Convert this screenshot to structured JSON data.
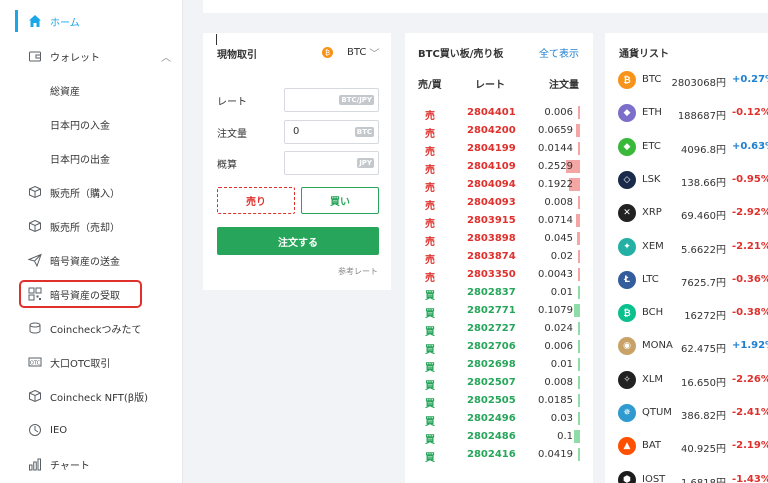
{
  "sidebar": {
    "items": [
      {
        "label": "ホーム",
        "icon": "home-icon"
      },
      {
        "label": "ウォレット",
        "icon": "wallet-icon"
      },
      {
        "label": "総資産"
      },
      {
        "label": "日本円の入金"
      },
      {
        "label": "日本円の出金"
      },
      {
        "label": "販売所（購入）",
        "icon": "box-icon"
      },
      {
        "label": "販売所（売却）",
        "icon": "box-icon"
      },
      {
        "label": "暗号資産の送金",
        "icon": "paper-plane-icon"
      },
      {
        "label": "暗号資産の受取",
        "icon": "qr-code-icon"
      },
      {
        "label": "Coincheckつみたて",
        "icon": "coin-stack-icon"
      },
      {
        "label": "大口OTC取引",
        "icon": "otc-icon"
      },
      {
        "label": "Coincheck NFT(β版)",
        "icon": "nft-cube-icon"
      },
      {
        "label": "IEO",
        "icon": "ieo-icon"
      },
      {
        "label": "チャート",
        "icon": "bar-chart-icon"
      }
    ]
  },
  "spot": {
    "title": "現物取引",
    "coin": "BTC",
    "rate_label": "レート",
    "rate_unit": "BTC/JPY",
    "qty_label": "注文量",
    "qty_value": "0",
    "qty_unit": "BTC",
    "approx_label": "概算",
    "approx_unit": "JPY",
    "sell_label": "売り",
    "buy_label": "買い",
    "order_label": "注文する",
    "ref_rate_label": "参考レート"
  },
  "orderbook": {
    "title": "BTC買い板/売り板",
    "show_all": "全て表示",
    "col_side": "売/買",
    "col_rate": "レート",
    "col_amount": "注文量",
    "rows": [
      {
        "side": "売",
        "rate": "2804401",
        "amount": "0.006",
        "depth": 0.02
      },
      {
        "side": "売",
        "rate": "2804200",
        "amount": "0.0659",
        "depth": 0.26
      },
      {
        "side": "売",
        "rate": "2804199",
        "amount": "0.0144",
        "depth": 0.06
      },
      {
        "side": "売",
        "rate": "2804109",
        "amount": "0.2529",
        "depth": 1.0
      },
      {
        "side": "売",
        "rate": "2804094",
        "amount": "0.1922",
        "depth": 0.76
      },
      {
        "side": "売",
        "rate": "2804093",
        "amount": "0.008",
        "depth": 0.03
      },
      {
        "side": "売",
        "rate": "2803915",
        "amount": "0.0714",
        "depth": 0.28
      },
      {
        "side": "売",
        "rate": "2803898",
        "amount": "0.045",
        "depth": 0.18
      },
      {
        "side": "売",
        "rate": "2803874",
        "amount": "0.02",
        "depth": 0.08
      },
      {
        "side": "売",
        "rate": "2803350",
        "amount": "0.0043",
        "depth": 0.02
      },
      {
        "side": "買",
        "rate": "2802837",
        "amount": "0.01",
        "depth": 0.04
      },
      {
        "side": "買",
        "rate": "2802771",
        "amount": "0.1079",
        "depth": 0.43
      },
      {
        "side": "買",
        "rate": "2802727",
        "amount": "0.024",
        "depth": 0.09
      },
      {
        "side": "買",
        "rate": "2802706",
        "amount": "0.006",
        "depth": 0.02
      },
      {
        "side": "買",
        "rate": "2802698",
        "amount": "0.01",
        "depth": 0.04
      },
      {
        "side": "買",
        "rate": "2802507",
        "amount": "0.008",
        "depth": 0.03
      },
      {
        "side": "買",
        "rate": "2802505",
        "amount": "0.0185",
        "depth": 0.07
      },
      {
        "side": "買",
        "rate": "2802496",
        "amount": "0.03",
        "depth": 0.12
      },
      {
        "side": "買",
        "rate": "2802486",
        "amount": "0.1",
        "depth": 0.4
      },
      {
        "side": "買",
        "rate": "2802416",
        "amount": "0.0419",
        "depth": 0.17
      }
    ]
  },
  "currencies": {
    "title": "通貨リスト",
    "rows": [
      {
        "symbol": "BTC",
        "price": "2803068円",
        "change": "+0.27%",
        "dir": "up",
        "icon": "btc-icon",
        "color": "#f7931a",
        "glyph": "₿"
      },
      {
        "symbol": "ETH",
        "price": "188687円",
        "change": "-0.12%",
        "dir": "down",
        "icon": "eth-icon",
        "color": "#7b6fc9",
        "glyph": "◆"
      },
      {
        "symbol": "ETC",
        "price": "4096.8円",
        "change": "+0.63%",
        "dir": "up",
        "icon": "etc-icon",
        "color": "#3ab83a",
        "glyph": "◆"
      },
      {
        "symbol": "LSK",
        "price": "138.66円",
        "change": "-0.95%",
        "dir": "down",
        "icon": "lsk-icon",
        "color": "#1a2a4a",
        "glyph": "◇"
      },
      {
        "symbol": "XRP",
        "price": "69.460円",
        "change": "-2.92%",
        "dir": "down",
        "icon": "xrp-icon",
        "color": "#222222",
        "glyph": "✕"
      },
      {
        "symbol": "XEM",
        "price": "5.6622円",
        "change": "-2.21%",
        "dir": "down",
        "icon": "xem-icon",
        "color": "#25b0a6",
        "glyph": "✦"
      },
      {
        "symbol": "LTC",
        "price": "7625.7円",
        "change": "-0.36%",
        "dir": "down",
        "icon": "ltc-icon",
        "color": "#345d9d",
        "glyph": "Ł"
      },
      {
        "symbol": "BCH",
        "price": "16272円",
        "change": "-0.38%",
        "dir": "down",
        "icon": "bch-icon",
        "color": "#0ac18e",
        "glyph": "₿"
      },
      {
        "symbol": "MONA",
        "price": "62.475円",
        "change": "+1.92%",
        "dir": "up",
        "icon": "mona-icon",
        "color": "#c8a266",
        "glyph": "◉"
      },
      {
        "symbol": "XLM",
        "price": "16.650円",
        "change": "-2.26%",
        "dir": "down",
        "icon": "xlm-icon",
        "color": "#222222",
        "glyph": "✧"
      },
      {
        "symbol": "QTUM",
        "price": "386.82円",
        "change": "-2.41%",
        "dir": "down",
        "icon": "qtum-icon",
        "color": "#2e9ad0",
        "glyph": "✵"
      },
      {
        "symbol": "BAT",
        "price": "40.925円",
        "change": "-2.19%",
        "dir": "down",
        "icon": "bat-icon",
        "color": "#ff5000",
        "glyph": "▲"
      },
      {
        "symbol": "IOST",
        "price": "1.6818円",
        "change": "-1.43%",
        "dir": "down",
        "icon": "iost-icon",
        "color": "#1c1c1c",
        "glyph": "⬢"
      }
    ]
  }
}
